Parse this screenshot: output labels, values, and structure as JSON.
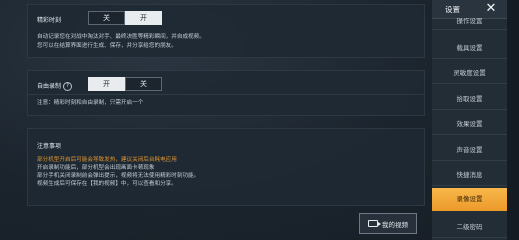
{
  "highlights": {
    "title": "精彩时刻",
    "off_label": "关",
    "on_label": "开",
    "desc_line1": "自动记录您在对战中淘汰对手、最终决胜等精彩瞬间，并自成视频。",
    "desc_line2": "您可以在结算界面进行生成、保存，并分享给您的朋友。"
  },
  "auto_record": {
    "title": "自由录制",
    "on_label": "开",
    "off_label": "关",
    "note": "注意：精彩时刻和自由录制，只需开启一个"
  },
  "notes": {
    "title": "注意事项",
    "line1": "部分机型开启后可能会导致发热，建议关闭后台耗电应用",
    "line2": "开启录制功能后，部分机型会出现画面卡顿现象",
    "line3": "部分手机关闭录制前会弹出提示，视频将无法使用精彩时刻功能。",
    "line4": "视频生成后可保存在【我的视频】中，可以查看和分享。"
  },
  "my_video_button": "我的视频",
  "sidebar": {
    "title": "设置",
    "close": "✕",
    "items": [
      {
        "label": "操作设置"
      },
      {
        "label": "载具设置"
      },
      {
        "label": "灵敏度设置"
      },
      {
        "label": "拾取设置"
      },
      {
        "label": "效果设置"
      },
      {
        "label": "声音设置"
      },
      {
        "label": "快捷消息"
      },
      {
        "label": "录像设置"
      },
      {
        "label": "二级密码"
      }
    ]
  },
  "colors": {
    "accent": "#f0a43a",
    "highlight_text": "#e3b64f",
    "warning_text": "#e0962f"
  }
}
